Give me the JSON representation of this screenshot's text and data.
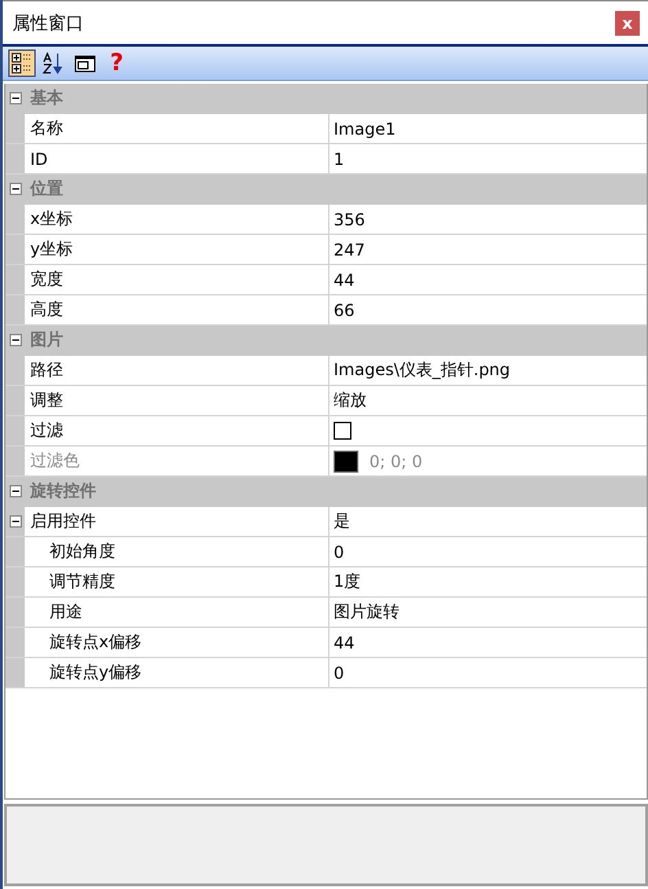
{
  "window": {
    "title": "属性窗口",
    "close": "x"
  },
  "toolbar": [
    {
      "kind": "categorized",
      "selected": true
    },
    {
      "kind": "alphabetical",
      "selected": false
    },
    {
      "kind": "pages",
      "selected": false
    },
    {
      "kind": "help",
      "label": "?",
      "selected": false
    }
  ],
  "categories": [
    {
      "name": "基本",
      "expanded": true,
      "rows": [
        {
          "kind": "text",
          "name": "名称",
          "value": "Image1",
          "disabled": false
        },
        {
          "kind": "text",
          "name": "ID",
          "value": "1",
          "disabled": false
        }
      ]
    },
    {
      "name": "位置",
      "expanded": true,
      "rows": [
        {
          "kind": "text",
          "name": "x坐标",
          "value": "356",
          "disabled": false
        },
        {
          "kind": "text",
          "name": "y坐标",
          "value": "247",
          "disabled": false
        },
        {
          "kind": "text",
          "name": "宽度",
          "value": "44",
          "disabled": false
        },
        {
          "kind": "text",
          "name": "高度",
          "value": "66",
          "disabled": false
        }
      ]
    },
    {
      "name": "图片",
      "expanded": true,
      "rows": [
        {
          "kind": "text",
          "name": "路径",
          "value": "Images\\仪表_指针.png",
          "disabled": false
        },
        {
          "kind": "text",
          "name": "调整",
          "value": "缩放",
          "disabled": false
        },
        {
          "kind": "checkbox",
          "name": "过滤",
          "checked": false,
          "disabled": false
        },
        {
          "kind": "color",
          "name": "过滤色",
          "color": "#000000",
          "value": "0; 0; 0",
          "disabled": true
        }
      ]
    },
    {
      "name": "旋转控件",
      "expanded": true,
      "rows": [
        {
          "kind": "text",
          "name": "启用控件",
          "value": "是",
          "disabled": false,
          "expanded": true,
          "children": [
            {
              "kind": "text",
              "name": "初始角度",
              "value": "0",
              "disabled": false
            },
            {
              "kind": "text",
              "name": "调节精度",
              "value": "1度",
              "disabled": false
            },
            {
              "kind": "text",
              "name": "用途",
              "value": "图片旋转",
              "disabled": false
            },
            {
              "kind": "text",
              "name": "旋转点x偏移",
              "value": "44",
              "disabled": false
            },
            {
              "kind": "text",
              "name": "旋转点y偏移",
              "value": "0",
              "disabled": false
            }
          ]
        }
      ]
    }
  ]
}
